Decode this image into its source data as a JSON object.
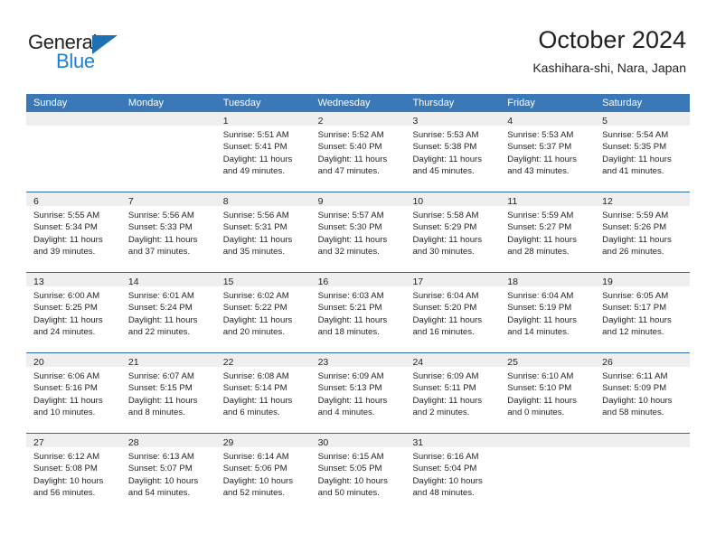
{
  "brand": {
    "name_top": "General",
    "name_bottom": "Blue",
    "accent_color": "#1f7fd4",
    "triangle_color": "#1f6fb5"
  },
  "header": {
    "title": "October 2024",
    "subtitle": "Kashihara-shi, Nara, Japan"
  },
  "theme": {
    "header_row_bg": "#3b78b8",
    "day_number_bg": "#efefef",
    "row_divider": "#2e6ca8",
    "text": "#231f20"
  },
  "weekdays": [
    "Sunday",
    "Monday",
    "Tuesday",
    "Wednesday",
    "Thursday",
    "Friday",
    "Saturday"
  ],
  "weeks": [
    [
      {
        "day": "",
        "empty": true,
        "l1": "",
        "l2": "",
        "l3": "",
        "l4": ""
      },
      {
        "day": "",
        "empty": true,
        "l1": "",
        "l2": "",
        "l3": "",
        "l4": ""
      },
      {
        "day": "1",
        "l1": "Sunrise: 5:51 AM",
        "l2": "Sunset: 5:41 PM",
        "l3": "Daylight: 11 hours",
        "l4": "and 49 minutes."
      },
      {
        "day": "2",
        "l1": "Sunrise: 5:52 AM",
        "l2": "Sunset: 5:40 PM",
        "l3": "Daylight: 11 hours",
        "l4": "and 47 minutes."
      },
      {
        "day": "3",
        "l1": "Sunrise: 5:53 AM",
        "l2": "Sunset: 5:38 PM",
        "l3": "Daylight: 11 hours",
        "l4": "and 45 minutes."
      },
      {
        "day": "4",
        "l1": "Sunrise: 5:53 AM",
        "l2": "Sunset: 5:37 PM",
        "l3": "Daylight: 11 hours",
        "l4": "and 43 minutes."
      },
      {
        "day": "5",
        "l1": "Sunrise: 5:54 AM",
        "l2": "Sunset: 5:35 PM",
        "l3": "Daylight: 11 hours",
        "l4": "and 41 minutes."
      }
    ],
    [
      {
        "day": "6",
        "l1": "Sunrise: 5:55 AM",
        "l2": "Sunset: 5:34 PM",
        "l3": "Daylight: 11 hours",
        "l4": "and 39 minutes."
      },
      {
        "day": "7",
        "l1": "Sunrise: 5:56 AM",
        "l2": "Sunset: 5:33 PM",
        "l3": "Daylight: 11 hours",
        "l4": "and 37 minutes."
      },
      {
        "day": "8",
        "l1": "Sunrise: 5:56 AM",
        "l2": "Sunset: 5:31 PM",
        "l3": "Daylight: 11 hours",
        "l4": "and 35 minutes."
      },
      {
        "day": "9",
        "l1": "Sunrise: 5:57 AM",
        "l2": "Sunset: 5:30 PM",
        "l3": "Daylight: 11 hours",
        "l4": "and 32 minutes."
      },
      {
        "day": "10",
        "l1": "Sunrise: 5:58 AM",
        "l2": "Sunset: 5:29 PM",
        "l3": "Daylight: 11 hours",
        "l4": "and 30 minutes."
      },
      {
        "day": "11",
        "l1": "Sunrise: 5:59 AM",
        "l2": "Sunset: 5:27 PM",
        "l3": "Daylight: 11 hours",
        "l4": "and 28 minutes."
      },
      {
        "day": "12",
        "l1": "Sunrise: 5:59 AM",
        "l2": "Sunset: 5:26 PM",
        "l3": "Daylight: 11 hours",
        "l4": "and 26 minutes."
      }
    ],
    [
      {
        "day": "13",
        "l1": "Sunrise: 6:00 AM",
        "l2": "Sunset: 5:25 PM",
        "l3": "Daylight: 11 hours",
        "l4": "and 24 minutes."
      },
      {
        "day": "14",
        "l1": "Sunrise: 6:01 AM",
        "l2": "Sunset: 5:24 PM",
        "l3": "Daylight: 11 hours",
        "l4": "and 22 minutes."
      },
      {
        "day": "15",
        "l1": "Sunrise: 6:02 AM",
        "l2": "Sunset: 5:22 PM",
        "l3": "Daylight: 11 hours",
        "l4": "and 20 minutes."
      },
      {
        "day": "16",
        "l1": "Sunrise: 6:03 AM",
        "l2": "Sunset: 5:21 PM",
        "l3": "Daylight: 11 hours",
        "l4": "and 18 minutes."
      },
      {
        "day": "17",
        "l1": "Sunrise: 6:04 AM",
        "l2": "Sunset: 5:20 PM",
        "l3": "Daylight: 11 hours",
        "l4": "and 16 minutes."
      },
      {
        "day": "18",
        "l1": "Sunrise: 6:04 AM",
        "l2": "Sunset: 5:19 PM",
        "l3": "Daylight: 11 hours",
        "l4": "and 14 minutes."
      },
      {
        "day": "19",
        "l1": "Sunrise: 6:05 AM",
        "l2": "Sunset: 5:17 PM",
        "l3": "Daylight: 11 hours",
        "l4": "and 12 minutes."
      }
    ],
    [
      {
        "day": "20",
        "l1": "Sunrise: 6:06 AM",
        "l2": "Sunset: 5:16 PM",
        "l3": "Daylight: 11 hours",
        "l4": "and 10 minutes."
      },
      {
        "day": "21",
        "l1": "Sunrise: 6:07 AM",
        "l2": "Sunset: 5:15 PM",
        "l3": "Daylight: 11 hours",
        "l4": "and 8 minutes."
      },
      {
        "day": "22",
        "l1": "Sunrise: 6:08 AM",
        "l2": "Sunset: 5:14 PM",
        "l3": "Daylight: 11 hours",
        "l4": "and 6 minutes."
      },
      {
        "day": "23",
        "l1": "Sunrise: 6:09 AM",
        "l2": "Sunset: 5:13 PM",
        "l3": "Daylight: 11 hours",
        "l4": "and 4 minutes."
      },
      {
        "day": "24",
        "l1": "Sunrise: 6:09 AM",
        "l2": "Sunset: 5:11 PM",
        "l3": "Daylight: 11 hours",
        "l4": "and 2 minutes."
      },
      {
        "day": "25",
        "l1": "Sunrise: 6:10 AM",
        "l2": "Sunset: 5:10 PM",
        "l3": "Daylight: 11 hours",
        "l4": "and 0 minutes."
      },
      {
        "day": "26",
        "l1": "Sunrise: 6:11 AM",
        "l2": "Sunset: 5:09 PM",
        "l3": "Daylight: 10 hours",
        "l4": "and 58 minutes."
      }
    ],
    [
      {
        "day": "27",
        "l1": "Sunrise: 6:12 AM",
        "l2": "Sunset: 5:08 PM",
        "l3": "Daylight: 10 hours",
        "l4": "and 56 minutes."
      },
      {
        "day": "28",
        "l1": "Sunrise: 6:13 AM",
        "l2": "Sunset: 5:07 PM",
        "l3": "Daylight: 10 hours",
        "l4": "and 54 minutes."
      },
      {
        "day": "29",
        "l1": "Sunrise: 6:14 AM",
        "l2": "Sunset: 5:06 PM",
        "l3": "Daylight: 10 hours",
        "l4": "and 52 minutes."
      },
      {
        "day": "30",
        "l1": "Sunrise: 6:15 AM",
        "l2": "Sunset: 5:05 PM",
        "l3": "Daylight: 10 hours",
        "l4": "and 50 minutes."
      },
      {
        "day": "31",
        "l1": "Sunrise: 6:16 AM",
        "l2": "Sunset: 5:04 PM",
        "l3": "Daylight: 10 hours",
        "l4": "and 48 minutes."
      },
      {
        "day": "",
        "empty": true,
        "l1": "",
        "l2": "",
        "l3": "",
        "l4": ""
      },
      {
        "day": "",
        "empty": true,
        "l1": "",
        "l2": "",
        "l3": "",
        "l4": ""
      }
    ]
  ]
}
